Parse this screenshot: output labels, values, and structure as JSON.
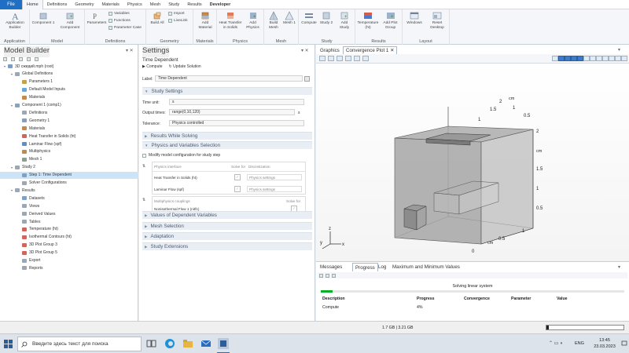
{
  "menubar": {
    "file": "File",
    "items": [
      "Home",
      "Definitions",
      "Geometry",
      "Materials",
      "Physics",
      "Mesh",
      "Study",
      "Results",
      "Developer"
    ]
  },
  "ribbon": {
    "groups": [
      "Application",
      "Model",
      "Definitions",
      "Geometry",
      "Materials",
      "Physics",
      "Mesh",
      "Study",
      "Results",
      "Layout"
    ],
    "application_builder": "Application Builder",
    "component": "Component 1",
    "add_component": "Add Component",
    "parameters": "Parameters",
    "variables": "Variables",
    "functions": "Functions",
    "parameter_case": "Parameter Case",
    "build_all": "Build All",
    "import": "Import",
    "livelink": "LiveLink",
    "add_material": "Add Material",
    "heat_transfer": "Heat Transfer in Solids",
    "add_physics": "Add Physics",
    "build_mesh": "Build Mesh",
    "mesh1": "Mesh 1",
    "compute": "Compute",
    "study2": "Study 2",
    "add_study": "Add Study",
    "temperature": "Temperature (ht)",
    "add_plot_group": "Add Plot Group",
    "windows": "Windows",
    "reset_desktop": "Reset Desktop"
  },
  "model_builder": {
    "title": "Model Builder",
    "tree": [
      {
        "label": "3D сжидий.mph (root)",
        "depth": 0,
        "color": "#7a9cc6"
      },
      {
        "label": "Global Definitions",
        "depth": 1,
        "color": "#9aa7b5"
      },
      {
        "label": "Parameters 1",
        "depth": 2,
        "color": "#c8a04a"
      },
      {
        "label": "Default Model Inputs",
        "depth": 2,
        "color": "#6aa6d6"
      },
      {
        "label": "Materials",
        "depth": 2,
        "color": "#c48a48"
      },
      {
        "label": "Component 1 (comp1)",
        "depth": 1,
        "color": "#8aa2bd"
      },
      {
        "label": "Definitions",
        "depth": 2,
        "color": "#9aa7b5"
      },
      {
        "label": "Geometry 1",
        "depth": 2,
        "color": "#7fa2c4"
      },
      {
        "label": "Materials",
        "depth": 2,
        "color": "#c48a48"
      },
      {
        "label": "Heat Transfer in Solids (ht)",
        "depth": 2,
        "color": "#d0665a"
      },
      {
        "label": "Laminar Flow (spf)",
        "depth": 2,
        "color": "#5a8fd0"
      },
      {
        "label": "Multiphysics",
        "depth": 2,
        "color": "#c08a4a"
      },
      {
        "label": "Mesh 1",
        "depth": 2,
        "color": "#8aa08a"
      },
      {
        "label": "Study 2",
        "depth": 1,
        "color": "#9aa7b5"
      },
      {
        "label": "Step 1: Time Dependent",
        "depth": 2,
        "color": "#7fa2c4",
        "selected": true
      },
      {
        "label": "Solver Configurations",
        "depth": 2,
        "color": "#9aa7b5"
      },
      {
        "label": "Results",
        "depth": 1,
        "color": "#9aa7b5"
      },
      {
        "label": "Datasets",
        "depth": 2,
        "color": "#7fa2c4"
      },
      {
        "label": "Views",
        "depth": 2,
        "color": "#9aa7b5"
      },
      {
        "label": "Derived Values",
        "depth": 2,
        "color": "#9aa7b5"
      },
      {
        "label": "Tables",
        "depth": 2,
        "color": "#9aa7b5"
      },
      {
        "label": "Temperature (ht)",
        "depth": 2,
        "color": "#d0665a"
      },
      {
        "label": "Isothermal Contours (ht)",
        "depth": 2,
        "color": "#d0665a"
      },
      {
        "label": "3D Plot Group 3",
        "depth": 2,
        "color": "#d0665a"
      },
      {
        "label": "3D Plot Group 5",
        "depth": 2,
        "color": "#d0665a"
      },
      {
        "label": "Export",
        "depth": 2,
        "color": "#9aa7b5"
      },
      {
        "label": "Reports",
        "depth": 2,
        "color": "#9aa7b5"
      }
    ]
  },
  "settings": {
    "title": "Settings",
    "subtitle": "Time Dependent",
    "compute": "Compute",
    "update_solution": "Update Solution",
    "label_caption": "Label:",
    "label_value": "Time Dependent",
    "section_study_settings": "Study Settings",
    "time_unit_caption": "Time unit:",
    "time_unit_value": "s",
    "output_times_caption": "Output times:",
    "output_times_value": "range(0,10,120)",
    "output_times_unit": "s",
    "tolerance_caption": "Tolerance:",
    "tolerance_value": "Physics controlled",
    "section_results_solving": "Results While Solving",
    "section_physics_vars": "Physics and Variables Selection",
    "modify_config": "Modify model configuration for study step",
    "table_head_physics": "Physics interface",
    "table_head_solve": "Solve for",
    "table_head_disc": "Discretization",
    "row1_name": "Heat Transfer in Solids (ht)",
    "row1_disc": "Physics settings",
    "row2_name": "Laminar Flow (spf)",
    "row2_disc": "Physics settings",
    "mp_head": "Multiphysics couplings",
    "mp_solve": "Solve for",
    "mp_row": "Nonisothermal Flow 1 (nitf1)",
    "section_dep_vars": "Values of Dependent Variables",
    "section_mesh": "Mesh Selection",
    "section_adapt": "Adaptation",
    "section_ext": "Study Extensions"
  },
  "graphics": {
    "tab1": "Graphics",
    "tab2": "Convergence Plot 1",
    "axis_unit": "cm",
    "ticks_top_x": [
      "1",
      "1.5",
      "2"
    ],
    "ticks_top_y": [
      "1",
      "0.5"
    ],
    "ticks_right": [
      "2",
      "1.5",
      "1",
      "0.5"
    ],
    "ticks_bottom": [
      "0",
      "0.5",
      "1"
    ],
    "axes_letters": [
      "y",
      "z",
      "x"
    ]
  },
  "messages": {
    "tabs": [
      "Messages",
      "Progress",
      "Log",
      "Maximum and Minimum Values"
    ],
    "status": "Solving linear system",
    "cols": [
      "Description",
      "Progress",
      "Convergence",
      "Parameter",
      "Value"
    ],
    "row_desc": "Compute",
    "row_progress": "4%",
    "progress_fraction": 0.04
  },
  "statusbar": {
    "memory": "1.7 GB | 3.21 GB"
  },
  "taskbar": {
    "search_placeholder": "Введите здесь текст для поиска",
    "lang": "ENG",
    "time": "13:45",
    "date": "23.03.2023"
  },
  "colors": {
    "accent": "#1f6fc5",
    "selection": "#cde3f6",
    "section": "#e9eef5"
  }
}
